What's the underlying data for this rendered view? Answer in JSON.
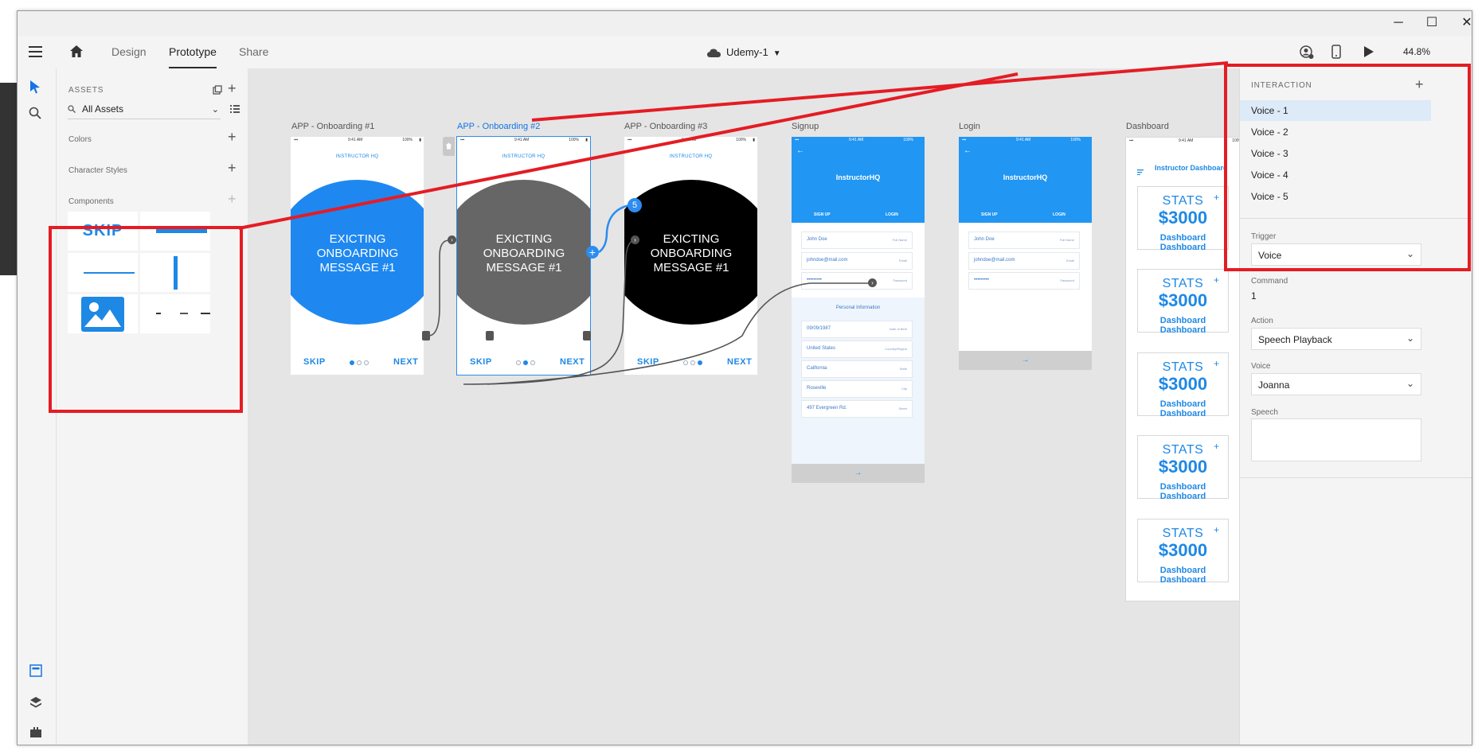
{
  "window": {
    "minimize": "─",
    "maximize": "☐",
    "close": "✕"
  },
  "toolbar": {
    "tabs": [
      {
        "label": "Design"
      },
      {
        "label": "Prototype"
      },
      {
        "label": "Share"
      }
    ],
    "document_title": "Udemy-1",
    "zoom": "44.8%"
  },
  "assets": {
    "heading": "ASSETS",
    "filter": "All Assets",
    "sections": [
      {
        "label": "Colors"
      },
      {
        "label": "Character Styles"
      },
      {
        "label": "Components"
      }
    ],
    "components": {
      "skip_label": "SKIP"
    }
  },
  "artboards": [
    {
      "title": "APP - Onboarding #1",
      "header": "INSTRUCTOR HQ",
      "lines": [
        "EXICTING",
        "ONBOARDING",
        "MESSAGE #1"
      ],
      "skip": "SKIP",
      "next": "NEXT",
      "circle_color": "#1e88f0",
      "active_dot": 0
    },
    {
      "title": "APP - Onboarding #2",
      "header": "INSTRUCTOR HQ",
      "lines": [
        "EXICTING",
        "ONBOARDING",
        "MESSAGE #1"
      ],
      "skip": "SKIP",
      "next": "NEXT",
      "circle_color": "#666666",
      "active_dot": 1
    },
    {
      "title": "APP - Onboarding #3",
      "header": "INSTRUCTOR HQ",
      "lines": [
        "EXICTING",
        "ONBOARDING",
        "MESSAGE #1"
      ],
      "skip": "SKIP",
      "next": "NEXT",
      "circle_color": "#000000",
      "active_dot": 2
    }
  ],
  "status_bar": {
    "time": "9:41 AM",
    "battery": "100%"
  },
  "connector_badge": "5",
  "signup": {
    "title": "Signup",
    "brand": "InstructorHQ",
    "tab_signup": "SIGN UP",
    "tab_login": "LOGIN",
    "fields": [
      {
        "value": "John Doe",
        "key": "Full Name"
      },
      {
        "value": "johndoe@mail.com",
        "key": "Email"
      },
      {
        "value": "•••••••••",
        "key": "Password"
      }
    ],
    "personal_heading": "Personal Information",
    "personal_fields": [
      {
        "value": "09/09/1987",
        "key": "Date of Birth"
      },
      {
        "value": "United States",
        "key": "Country/Region"
      },
      {
        "value": "California",
        "key": "State"
      },
      {
        "value": "Roseville",
        "key": "City"
      },
      {
        "value": "497 Evergreen Rd.",
        "key": "Street"
      }
    ],
    "arrow": "→",
    "back": "←"
  },
  "login": {
    "title": "Login",
    "brand": "InstructorHQ",
    "tab_signup": "SIGN UP",
    "tab_login": "LOGIN",
    "fields": [
      {
        "value": "John Doe",
        "key": "Full Name"
      },
      {
        "value": "johndoe@mail.com",
        "key": "Email"
      },
      {
        "value": "•••••••••",
        "key": "Password"
      }
    ],
    "arrow": "→",
    "back": "←"
  },
  "dashboard": {
    "title": "Dashboard",
    "header": "Instructor Dashboard",
    "cards": [
      {
        "title": "STATS",
        "value": "$3000",
        "label": "Dashboard Dashboard",
        "plus": "+"
      },
      {
        "title": "STATS",
        "value": "$3000",
        "label": "Dashboard Dashboard",
        "plus": "+"
      },
      {
        "title": "STATS",
        "value": "$3000",
        "label": "Dashboard Dashboard",
        "plus": "+"
      },
      {
        "title": "STATS",
        "value": "$3000",
        "label": "Dashboard Dashboard",
        "plus": "+"
      },
      {
        "title": "STATS",
        "value": "$3000",
        "label": "Dashboard Dashboard",
        "plus": "+"
      }
    ]
  },
  "interaction": {
    "heading": "INTERACTION",
    "voices": [
      {
        "label": "Voice - 1"
      },
      {
        "label": "Voice - 2"
      },
      {
        "label": "Voice - 3"
      },
      {
        "label": "Voice - 4"
      },
      {
        "label": "Voice - 5"
      }
    ],
    "trigger_label": "Trigger",
    "trigger_value": "Voice",
    "command_label": "Command",
    "command_value": "1",
    "action_label": "Action",
    "action_value": "Speech Playback",
    "voice_label": "Voice",
    "voice_value": "Joanna",
    "speech_label": "Speech"
  },
  "colors": {
    "accent": "#1e88e5",
    "annotation": "#e41c24",
    "selection": "#2d8cf0"
  }
}
